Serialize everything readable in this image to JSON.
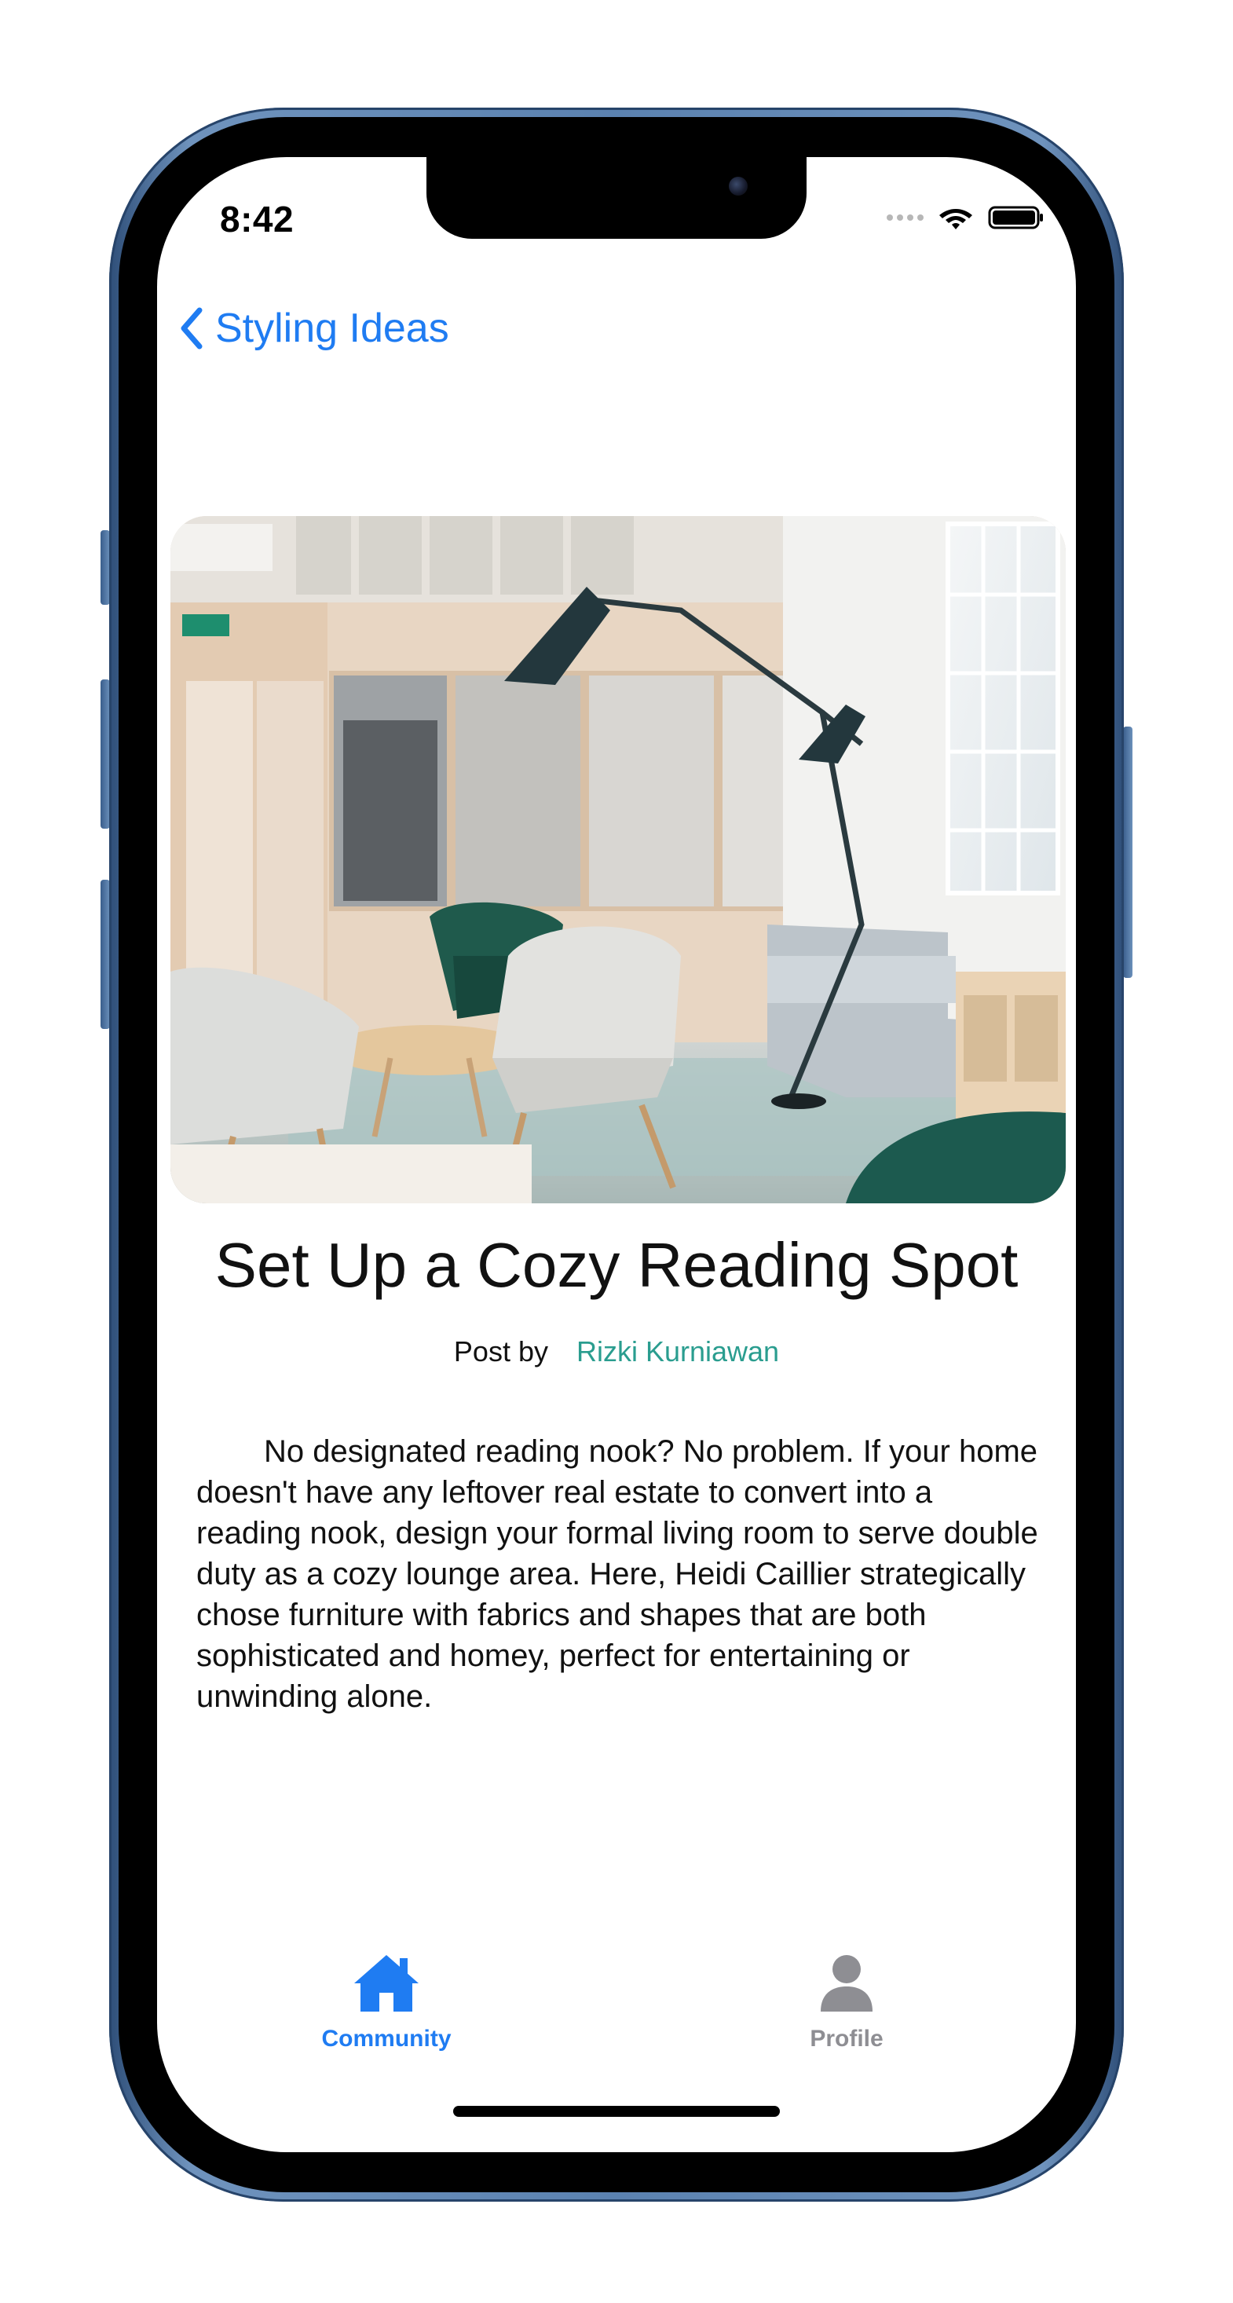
{
  "status_bar": {
    "time": "8:42"
  },
  "navigation": {
    "back_label": "Styling Ideas"
  },
  "post": {
    "title": "Set Up a Cozy Reading Spot",
    "byline_label": "Post by",
    "author": "Rizki Kurniawan",
    "body": "No designated reading nook? No problem. If your home doesn't have any leftover real estate to convert into a reading nook, design your formal living room to serve double duty as a cozy lounge area. Here, Heidi Caillier strategically chose furniture with fabrics and shapes that are both sophisticated and homey, perfect for entertaining or unwinding alone."
  },
  "tab_bar": {
    "tabs": [
      {
        "label": "Community",
        "icon": "home-icon",
        "selected": true
      },
      {
        "label": "Profile",
        "icon": "person-icon",
        "selected": false
      }
    ]
  },
  "colors": {
    "accent_blue": "#1f7cf2",
    "author_teal": "#2a9d8f",
    "inactive_gray": "#8e8e93",
    "frame_blue": "#5b82b0"
  }
}
